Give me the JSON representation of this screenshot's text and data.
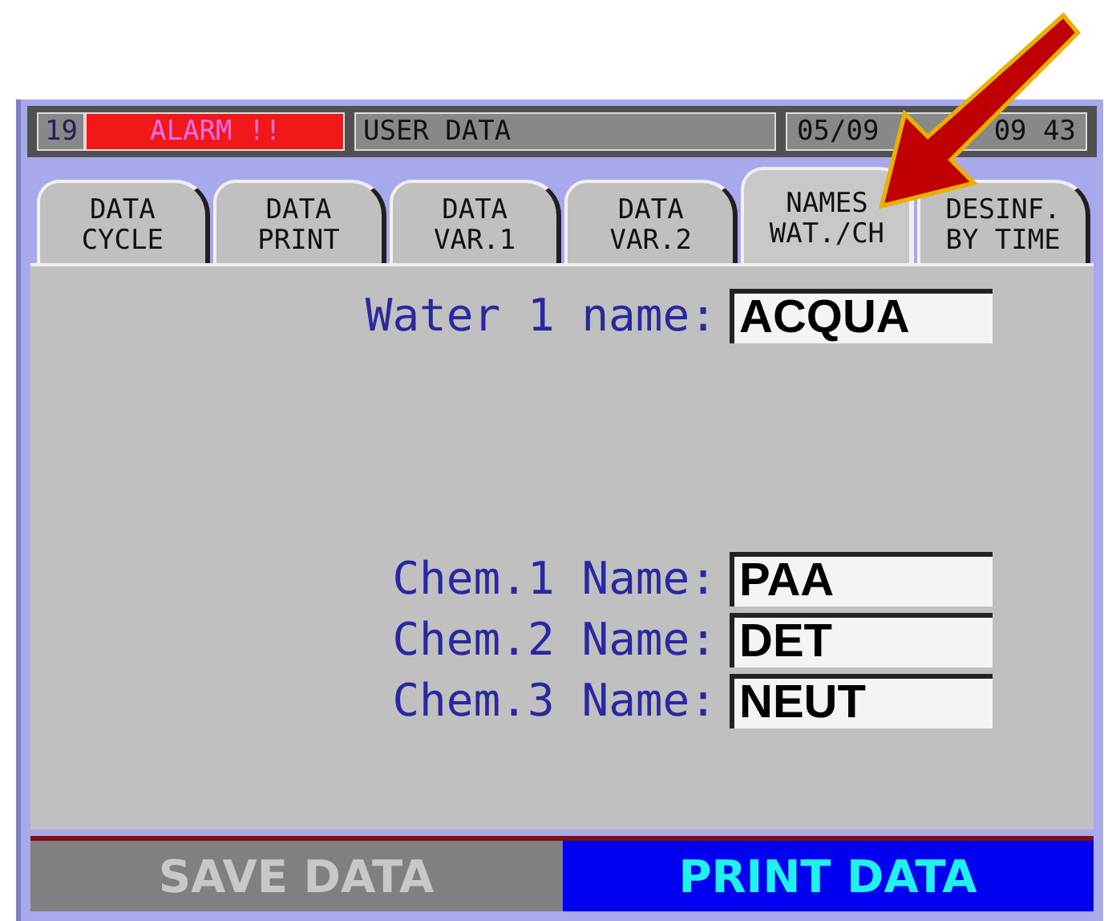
{
  "header": {
    "number": "19",
    "alarm": {
      "text": "ALARM !!",
      "active": true
    },
    "title": "USER DATA",
    "date": "05/09",
    "time": "09 43"
  },
  "tabs": [
    {
      "lines": [
        "DATA",
        "CYCLE"
      ],
      "selected": false
    },
    {
      "lines": [
        "DATA",
        "PRINT"
      ],
      "selected": false
    },
    {
      "lines": [
        "DATA",
        "VAR.1"
      ],
      "selected": false
    },
    {
      "lines": [
        "DATA",
        "VAR.2"
      ],
      "selected": false
    },
    {
      "lines": [
        "NAMES",
        "WAT./CH"
      ],
      "selected": true
    },
    {
      "lines": [
        "DESINF.",
        "BY TIME"
      ],
      "selected": false
    }
  ],
  "water_fields": [
    {
      "label": "Water 1 name:",
      "value": "ACQUA"
    }
  ],
  "chemical_fields": [
    {
      "label": "Chem.1 Name:",
      "value": "PAA"
    },
    {
      "label": "Chem.2 Name:",
      "value": "DET"
    },
    {
      "label": "Chem.3 Name:",
      "value": "NEUT"
    }
  ],
  "buttons": [
    {
      "label": "SAVE DATA",
      "disabled": true
    },
    {
      "label": "PRINT DATA",
      "disabled": false
    }
  ]
}
